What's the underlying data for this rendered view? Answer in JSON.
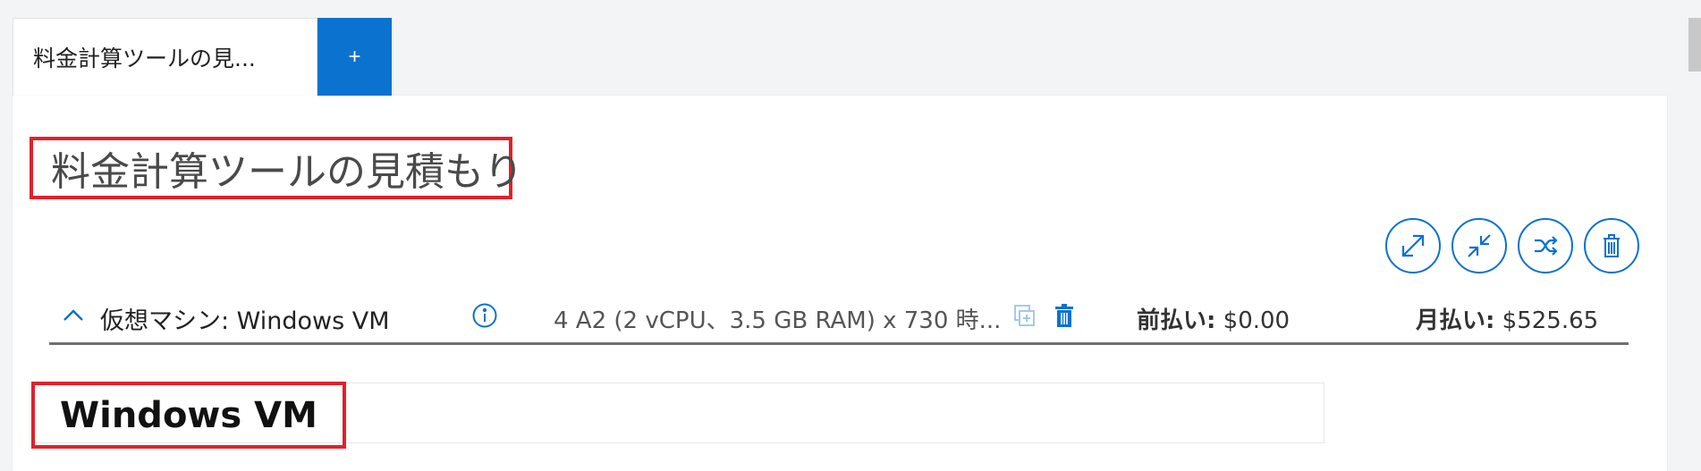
{
  "tabs": [
    {
      "label": "料金計算ツールの見..."
    }
  ],
  "add_tab_label": "+",
  "estimate": {
    "title": "料金計算ツールの見積もり"
  },
  "actions": [
    {
      "name": "expand-all-icon"
    },
    {
      "name": "collapse-all-icon"
    },
    {
      "name": "shuffle-icon"
    },
    {
      "name": "delete-all-icon"
    }
  ],
  "service_row": {
    "label": "仮想マシン: Windows VM",
    "summary": "4 A2 (2 vCPU、3.5 GB RAM) x 730 時...",
    "upfront_label": "前払い:",
    "upfront_value": " $0.00",
    "monthly_label": "月払い:",
    "monthly_value": " $525.65"
  },
  "name_field": {
    "value": "Windows VM"
  },
  "colors": {
    "accent": "#0b72cf",
    "highlight_box": "#e0212c",
    "divider": "#707070"
  }
}
